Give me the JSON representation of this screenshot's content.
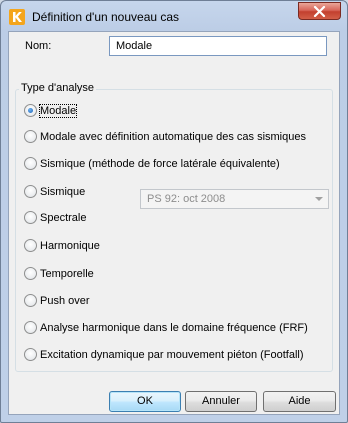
{
  "window": {
    "title": "Définition d'un nouveau cas"
  },
  "form": {
    "name_label": "Nom:",
    "name_value": "Modale"
  },
  "analysis": {
    "group_label": "Type d'analyse",
    "options": [
      {
        "label": "Modale",
        "checked": true
      },
      {
        "label": "Modale avec définition automatique des cas sismiques",
        "checked": false
      },
      {
        "label": "Sismique (méthode de force latérale équivalente)",
        "checked": false
      },
      {
        "label": "Sismique",
        "checked": false
      },
      {
        "label": "Spectrale",
        "checked": false
      },
      {
        "label": "Harmonique",
        "checked": false
      },
      {
        "label": "Temporelle",
        "checked": false
      },
      {
        "label": "Push over",
        "checked": false
      },
      {
        "label": "Analyse harmonique dans le domaine fréquence (FRF)",
        "checked": false
      },
      {
        "label": "Excitation dynamique par mouvement piéton (Footfall)",
        "checked": false
      }
    ],
    "seismic_code": {
      "value": "PS 92: oct 2008",
      "disabled": true
    }
  },
  "buttons": {
    "ok": "OK",
    "cancel": "Annuler",
    "help": "Aide"
  },
  "colors": {
    "title_bar": "#bccde6",
    "close_button": "#c3402f",
    "dialog_bg": "#f0f0f0",
    "default_button_border": "#3c7fb1"
  },
  "icons": {
    "app": "robot-k-logo-icon",
    "close": "close-icon",
    "dropdown": "chevron-down-icon"
  }
}
